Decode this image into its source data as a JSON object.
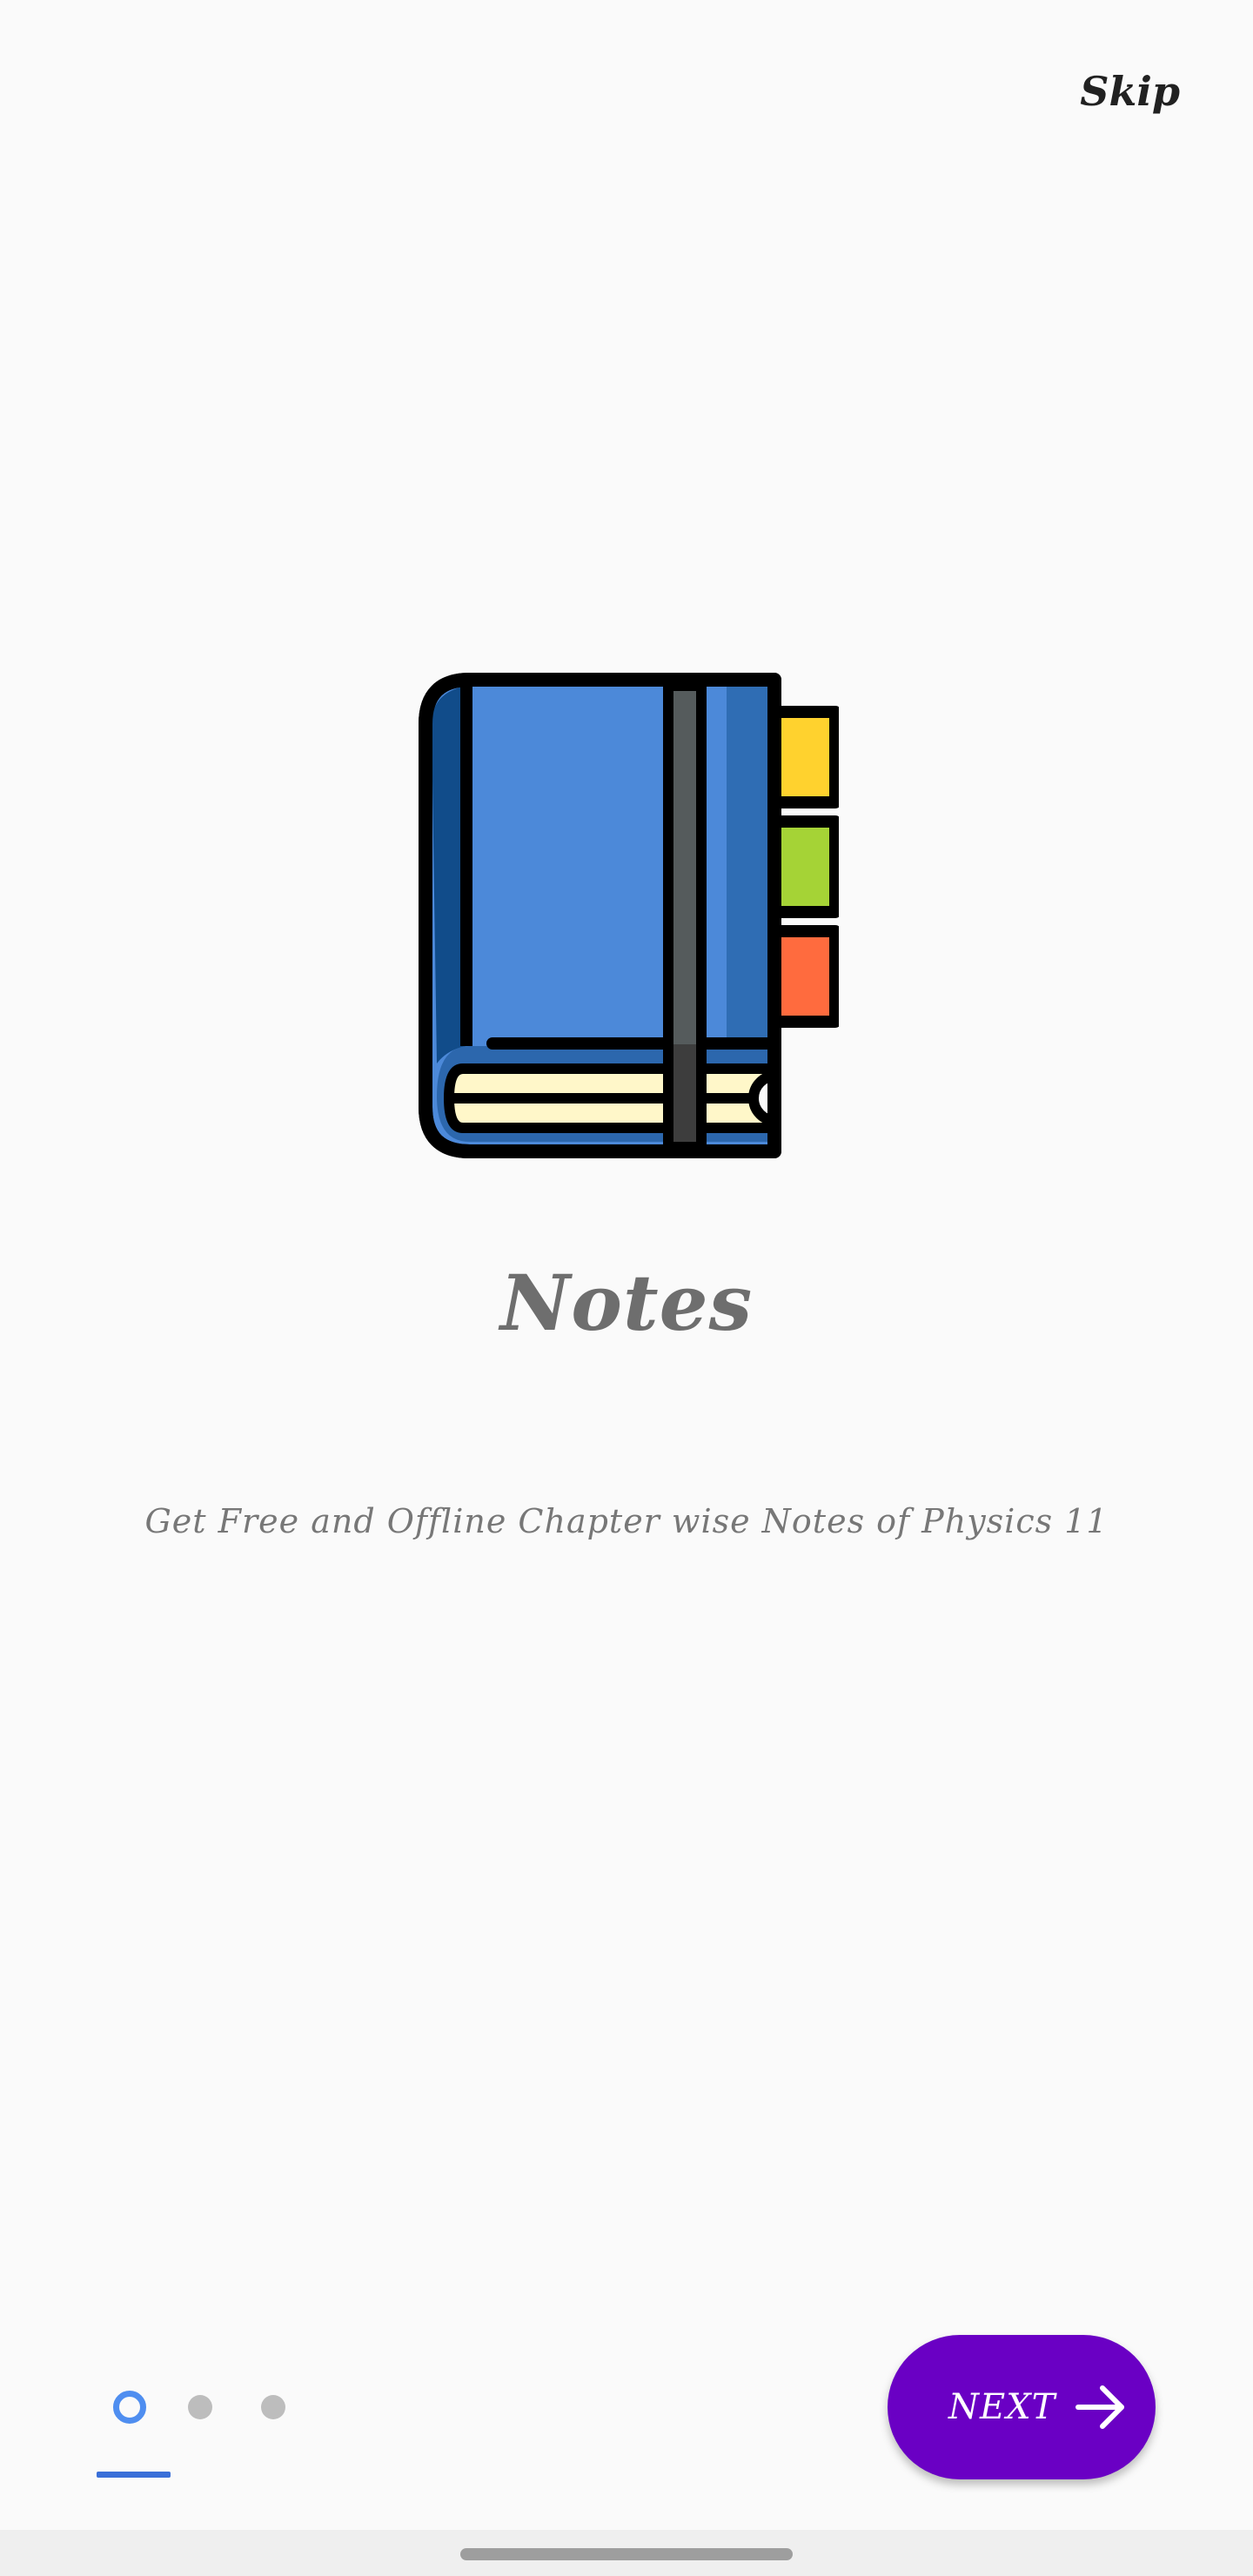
{
  "header": {
    "skip_label": "Skip"
  },
  "onboarding": {
    "title": "Notes",
    "subtitle": "Get Free and Offline Chapter wise Notes of Physics 11",
    "illustration": "notebook-icon",
    "current_page": 1,
    "total_pages": 3
  },
  "footer": {
    "next_label": "NEXT",
    "next_icon": "arrow-right-icon"
  },
  "colors": {
    "background": "#fafafa",
    "accent": "#6a00c4",
    "indicator_active": "#4f8ef0",
    "indicator_inactive": "#bdbdbd",
    "indicator_underline": "#3a6fd8"
  }
}
